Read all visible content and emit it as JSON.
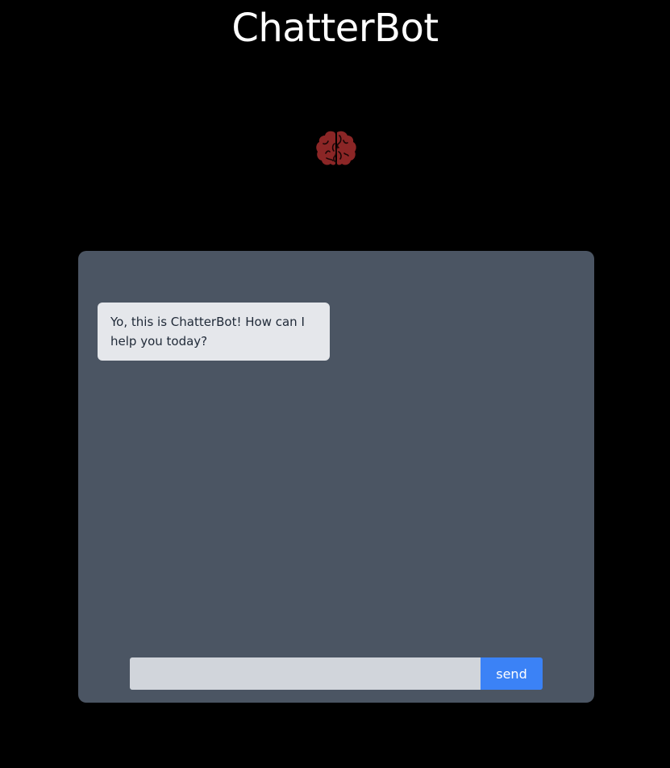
{
  "header": {
    "title": "ChatterBot"
  },
  "logo": {
    "icon": "brain-icon",
    "color": "#8b2626"
  },
  "chat": {
    "messages": [
      {
        "sender": "bot",
        "text": "Yo, this is ChatterBot! How can I help you today?"
      }
    ],
    "input": {
      "value": "",
      "placeholder": ""
    },
    "send_label": "send"
  },
  "colors": {
    "background": "#000000",
    "panel": "#4b5563",
    "bubble": "#e5e7eb",
    "input": "#d1d5db",
    "accent": "#3b82f6"
  }
}
